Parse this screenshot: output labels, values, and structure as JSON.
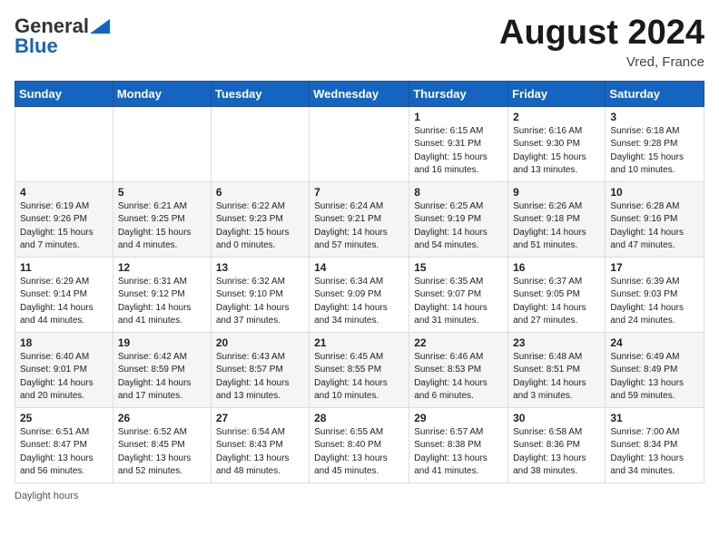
{
  "header": {
    "logo_general": "General",
    "logo_blue": "Blue",
    "month_year": "August 2024",
    "location": "Vred, France"
  },
  "days_of_week": [
    "Sunday",
    "Monday",
    "Tuesday",
    "Wednesday",
    "Thursday",
    "Friday",
    "Saturday"
  ],
  "weeks": [
    [
      {
        "day": "",
        "info": ""
      },
      {
        "day": "",
        "info": ""
      },
      {
        "day": "",
        "info": ""
      },
      {
        "day": "",
        "info": ""
      },
      {
        "day": "1",
        "info": "Sunrise: 6:15 AM\nSunset: 9:31 PM\nDaylight: 15 hours and 16 minutes."
      },
      {
        "day": "2",
        "info": "Sunrise: 6:16 AM\nSunset: 9:30 PM\nDaylight: 15 hours and 13 minutes."
      },
      {
        "day": "3",
        "info": "Sunrise: 6:18 AM\nSunset: 9:28 PM\nDaylight: 15 hours and 10 minutes."
      }
    ],
    [
      {
        "day": "4",
        "info": "Sunrise: 6:19 AM\nSunset: 9:26 PM\nDaylight: 15 hours and 7 minutes."
      },
      {
        "day": "5",
        "info": "Sunrise: 6:21 AM\nSunset: 9:25 PM\nDaylight: 15 hours and 4 minutes."
      },
      {
        "day": "6",
        "info": "Sunrise: 6:22 AM\nSunset: 9:23 PM\nDaylight: 15 hours and 0 minutes."
      },
      {
        "day": "7",
        "info": "Sunrise: 6:24 AM\nSunset: 9:21 PM\nDaylight: 14 hours and 57 minutes."
      },
      {
        "day": "8",
        "info": "Sunrise: 6:25 AM\nSunset: 9:19 PM\nDaylight: 14 hours and 54 minutes."
      },
      {
        "day": "9",
        "info": "Sunrise: 6:26 AM\nSunset: 9:18 PM\nDaylight: 14 hours and 51 minutes."
      },
      {
        "day": "10",
        "info": "Sunrise: 6:28 AM\nSunset: 9:16 PM\nDaylight: 14 hours and 47 minutes."
      }
    ],
    [
      {
        "day": "11",
        "info": "Sunrise: 6:29 AM\nSunset: 9:14 PM\nDaylight: 14 hours and 44 minutes."
      },
      {
        "day": "12",
        "info": "Sunrise: 6:31 AM\nSunset: 9:12 PM\nDaylight: 14 hours and 41 minutes."
      },
      {
        "day": "13",
        "info": "Sunrise: 6:32 AM\nSunset: 9:10 PM\nDaylight: 14 hours and 37 minutes."
      },
      {
        "day": "14",
        "info": "Sunrise: 6:34 AM\nSunset: 9:09 PM\nDaylight: 14 hours and 34 minutes."
      },
      {
        "day": "15",
        "info": "Sunrise: 6:35 AM\nSunset: 9:07 PM\nDaylight: 14 hours and 31 minutes."
      },
      {
        "day": "16",
        "info": "Sunrise: 6:37 AM\nSunset: 9:05 PM\nDaylight: 14 hours and 27 minutes."
      },
      {
        "day": "17",
        "info": "Sunrise: 6:39 AM\nSunset: 9:03 PM\nDaylight: 14 hours and 24 minutes."
      }
    ],
    [
      {
        "day": "18",
        "info": "Sunrise: 6:40 AM\nSunset: 9:01 PM\nDaylight: 14 hours and 20 minutes."
      },
      {
        "day": "19",
        "info": "Sunrise: 6:42 AM\nSunset: 8:59 PM\nDaylight: 14 hours and 17 minutes."
      },
      {
        "day": "20",
        "info": "Sunrise: 6:43 AM\nSunset: 8:57 PM\nDaylight: 14 hours and 13 minutes."
      },
      {
        "day": "21",
        "info": "Sunrise: 6:45 AM\nSunset: 8:55 PM\nDaylight: 14 hours and 10 minutes."
      },
      {
        "day": "22",
        "info": "Sunrise: 6:46 AM\nSunset: 8:53 PM\nDaylight: 14 hours and 6 minutes."
      },
      {
        "day": "23",
        "info": "Sunrise: 6:48 AM\nSunset: 8:51 PM\nDaylight: 14 hours and 3 minutes."
      },
      {
        "day": "24",
        "info": "Sunrise: 6:49 AM\nSunset: 8:49 PM\nDaylight: 13 hours and 59 minutes."
      }
    ],
    [
      {
        "day": "25",
        "info": "Sunrise: 6:51 AM\nSunset: 8:47 PM\nDaylight: 13 hours and 56 minutes."
      },
      {
        "day": "26",
        "info": "Sunrise: 6:52 AM\nSunset: 8:45 PM\nDaylight: 13 hours and 52 minutes."
      },
      {
        "day": "27",
        "info": "Sunrise: 6:54 AM\nSunset: 8:43 PM\nDaylight: 13 hours and 48 minutes."
      },
      {
        "day": "28",
        "info": "Sunrise: 6:55 AM\nSunset: 8:40 PM\nDaylight: 13 hours and 45 minutes."
      },
      {
        "day": "29",
        "info": "Sunrise: 6:57 AM\nSunset: 8:38 PM\nDaylight: 13 hours and 41 minutes."
      },
      {
        "day": "30",
        "info": "Sunrise: 6:58 AM\nSunset: 8:36 PM\nDaylight: 13 hours and 38 minutes."
      },
      {
        "day": "31",
        "info": "Sunrise: 7:00 AM\nSunset: 8:34 PM\nDaylight: 13 hours and 34 minutes."
      }
    ]
  ],
  "footer": {
    "note": "Daylight hours"
  }
}
